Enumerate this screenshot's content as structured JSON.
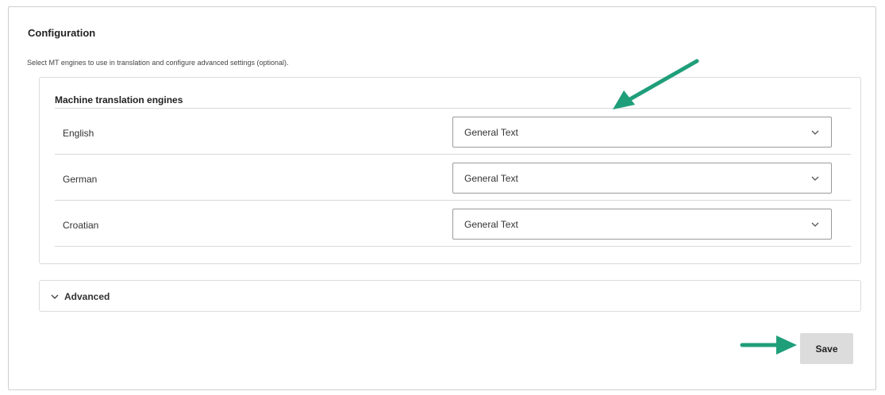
{
  "configuration": {
    "title": "Configuration",
    "description": "Select MT engines to use in translation and configure advanced settings (optional)."
  },
  "engines": {
    "title": "Machine translation engines",
    "rows": [
      {
        "language": "English",
        "engine": "General Text"
      },
      {
        "language": "German",
        "engine": "General Text"
      },
      {
        "language": "Croatian",
        "engine": "General Text"
      }
    ]
  },
  "advanced": {
    "label": "Advanced",
    "icon": "chevron-down-icon"
  },
  "actions": {
    "save_label": "Save"
  },
  "annotations": {
    "arrow_color": "#1f9e7a"
  }
}
